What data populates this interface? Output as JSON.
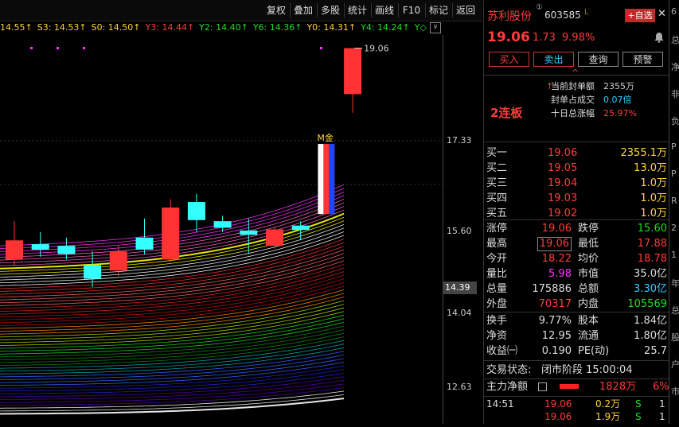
{
  "toolbar": {
    "buttons": [
      "复权",
      "叠加",
      "多股",
      "统计",
      "画线",
      "F10",
      "标记",
      "返回"
    ],
    "close": "✕"
  },
  "ma_row": [
    {
      "text": "14.55",
      "color": "#ffd23a",
      "arrow": "↑"
    },
    {
      "text": "S3: 14.53",
      "color": "#ffd23a",
      "arrow": "↑"
    },
    {
      "text": "S0: 14.50",
      "color": "#ffd23a",
      "arrow": "↑"
    },
    {
      "text": "Y3: 14.44",
      "color": "#ff3b3b",
      "arrow": "↑"
    },
    {
      "text": "Y2: 14.40",
      "color": "#22dd22",
      "arrow": "↑"
    },
    {
      "text": "Y6: 14.36",
      "color": "#22dd22",
      "arrow": "↑"
    },
    {
      "text": "Y0: 14.31",
      "color": "#ffd23a",
      "arrow": "↑"
    },
    {
      "text": "Y4: 14.24",
      "color": "#22dd22",
      "arrow": "↑"
    },
    {
      "text": "Y◇",
      "color": "#22dd22",
      "arrow": ""
    }
  ],
  "ma_toggle": "∨",
  "chart_data": {
    "type": "candlestick",
    "y_ticks": [
      "17.33",
      "15.60",
      "14.04",
      "12.63"
    ],
    "current_price_tag": "14.39",
    "high_label": "19.06",
    "marker_label": "M金",
    "candles": [
      {
        "o": 15.2,
        "c": 15.55,
        "h": 15.9,
        "l": 15.1,
        "up": true
      },
      {
        "o": 15.48,
        "c": 15.38,
        "h": 15.7,
        "l": 15.25,
        "up": false
      },
      {
        "o": 15.45,
        "c": 15.3,
        "h": 15.6,
        "l": 15.2,
        "up": false
      },
      {
        "o": 15.1,
        "c": 14.85,
        "h": 15.35,
        "l": 14.7,
        "up": false
      },
      {
        "o": 15.0,
        "c": 15.35,
        "h": 15.45,
        "l": 14.9,
        "up": true
      },
      {
        "o": 15.6,
        "c": 15.38,
        "h": 15.95,
        "l": 15.3,
        "up": false
      },
      {
        "o": 15.2,
        "c": 16.15,
        "h": 16.3,
        "l": 15.15,
        "up": true
      },
      {
        "o": 16.25,
        "c": 15.92,
        "h": 16.4,
        "l": 15.7,
        "up": false
      },
      {
        "o": 15.9,
        "c": 15.78,
        "h": 16.0,
        "l": 15.7,
        "up": false
      },
      {
        "o": 15.73,
        "c": 15.65,
        "h": 15.95,
        "l": 15.3,
        "up": false
      },
      {
        "o": 15.45,
        "c": 15.75,
        "h": 15.8,
        "l": 15.4,
        "up": true
      },
      {
        "o": 15.82,
        "c": 15.74,
        "h": 15.9,
        "l": 15.55,
        "up": false
      },
      {
        "o": 16.03,
        "c": 17.31,
        "h": 17.31,
        "l": 16.03,
        "up": true,
        "limit": true
      },
      {
        "o": 18.22,
        "c": 19.06,
        "h": 19.06,
        "l": 17.88,
        "up": true
      }
    ]
  },
  "panel": {
    "name": "苏利股份",
    "code": "603585",
    "info_icon": "①",
    "l_mark": "L",
    "add_btn": "+自选",
    "close": "✕",
    "price": "19.06",
    "change": "1.73",
    "pct": "9.98%",
    "bell": "bell-icon",
    "actions": [
      "买入",
      "卖出",
      "查询",
      "预警"
    ],
    "caret": "^",
    "badge": "2连板",
    "seal_rows": [
      {
        "label": "当前封单额",
        "value": "2355万",
        "color": "#ccc",
        "arrow": "↑"
      },
      {
        "label": "封单占成交",
        "value": "0.07倍",
        "color": "#33ccff",
        "arrow": ""
      },
      {
        "label": "十日总涨幅",
        "value": "25.97%",
        "color": "#ff3b3b",
        "arrow": ""
      }
    ],
    "bids": [
      {
        "label": "买一",
        "price": "19.06",
        "vol": "2355.1万"
      },
      {
        "label": "买二",
        "price": "19.05",
        "vol": "13.0万"
      },
      {
        "label": "买三",
        "price": "19.04",
        "vol": "1.0万"
      },
      {
        "label": "买四",
        "price": "19.03",
        "vol": "1.0万"
      },
      {
        "label": "买五",
        "price": "19.02",
        "vol": "1.0万"
      }
    ],
    "stats": [
      {
        "l1": "涨停",
        "v1": "19.06",
        "c1": "#ff3b3b",
        "l2": "跌停",
        "v2": "15.60",
        "c2": "#22dd22"
      },
      {
        "l1": "最高",
        "v1": "19.06",
        "c1": "#ff3b3b",
        "l2": "最低",
        "v2": "17.88",
        "c2": "#ff3b3b",
        "box": true
      },
      {
        "l1": "今开",
        "v1": "18.22",
        "c1": "#ff3b3b",
        "l2": "均价",
        "v2": "18.78",
        "c2": "#ff3b3b"
      },
      {
        "l1": "量比",
        "v1": "5.98",
        "c1": "#ff33ff",
        "l2": "市值",
        "v2": "35.0亿",
        "c2": "#ddd"
      },
      {
        "l1": "总量",
        "v1": "175886",
        "c1": "#ddd",
        "l2": "总额",
        "v2": "3.30亿",
        "c2": "#33ccff"
      },
      {
        "l1": "外盘",
        "v1": "70317",
        "c1": "#ff3b3b",
        "l2": "内盘",
        "v2": "105569",
        "c2": "#22dd22"
      }
    ],
    "stats2": [
      {
        "l1": "换手",
        "v1": "9.77%",
        "l2": "股本",
        "v2": "1.84亿"
      },
      {
        "l1": "净资",
        "v1": "12.95",
        "l2": "流通",
        "v2": "1.80亿"
      },
      {
        "l1": "收益㈠",
        "v1": "0.190",
        "l2": "PE(动)",
        "v2": "25.7"
      }
    ],
    "status_label": "交易状态:",
    "status_value": "闭市阶段 15:00:04",
    "main_force_label": "主力净额",
    "main_force_value": "1828万",
    "main_force_pct": "6%",
    "ticks": [
      {
        "time": "14:51",
        "price": "19.06",
        "vol": "0.2万",
        "side": "S",
        "n": "1"
      },
      {
        "time": "",
        "price": "19.06",
        "vol": "1.9万",
        "side": "S",
        "n": "1"
      }
    ]
  },
  "edge": [
    "6",
    "总",
    "净",
    "非",
    "负",
    "P",
    "P",
    "R",
    "2",
    "1",
    "年",
    "总",
    "股",
    "户",
    "市"
  ]
}
